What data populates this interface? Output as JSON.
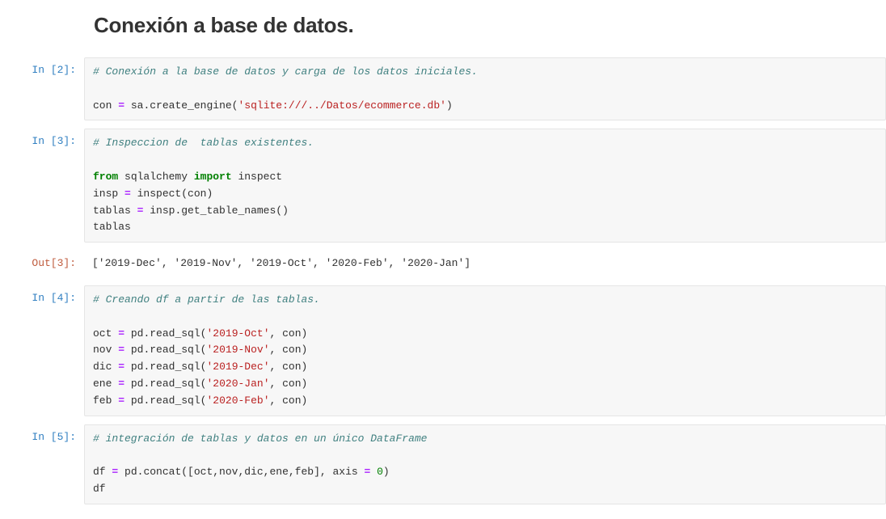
{
  "heading": "Conexión a base de datos.",
  "cells": [
    {
      "prompt": "In [2]:",
      "type": "input",
      "tokens": [
        {
          "t": "# Conexión a la base de datos y carga de los datos iniciales.",
          "c": "comment"
        },
        {
          "t": "\n\n",
          "c": "punct"
        },
        {
          "t": "con ",
          "c": "name"
        },
        {
          "t": "=",
          "c": "operator"
        },
        {
          "t": " sa",
          "c": "name"
        },
        {
          "t": ".",
          "c": "punct"
        },
        {
          "t": "create_engine",
          "c": "name"
        },
        {
          "t": "(",
          "c": "punct"
        },
        {
          "t": "'sqlite:///../Datos/ecommerce.db'",
          "c": "string"
        },
        {
          "t": ")",
          "c": "punct"
        }
      ]
    },
    {
      "prompt": "In [3]:",
      "type": "input",
      "tokens": [
        {
          "t": "# Inspeccion de  tablas existentes.",
          "c": "comment"
        },
        {
          "t": "\n\n",
          "c": "punct"
        },
        {
          "t": "from",
          "c": "keyword"
        },
        {
          "t": " sqlalchemy ",
          "c": "name"
        },
        {
          "t": "import",
          "c": "keyword"
        },
        {
          "t": " inspect\n",
          "c": "name"
        },
        {
          "t": "insp ",
          "c": "name"
        },
        {
          "t": "=",
          "c": "operator"
        },
        {
          "t": " inspect(con)\n",
          "c": "name"
        },
        {
          "t": "tablas ",
          "c": "name"
        },
        {
          "t": "=",
          "c": "operator"
        },
        {
          "t": " insp",
          "c": "name"
        },
        {
          "t": ".",
          "c": "punct"
        },
        {
          "t": "get_table_names()\n",
          "c": "name"
        },
        {
          "t": "tablas",
          "c": "name"
        }
      ]
    },
    {
      "prompt": "Out[3]:",
      "type": "output",
      "text": "['2019-Dec', '2019-Nov', '2019-Oct', '2020-Feb', '2020-Jan']"
    },
    {
      "prompt": "In [4]:",
      "type": "input",
      "tokens": [
        {
          "t": "# Creando df a partir de las tablas.",
          "c": "comment"
        },
        {
          "t": "\n\n",
          "c": "punct"
        },
        {
          "t": "oct ",
          "c": "name"
        },
        {
          "t": "=",
          "c": "operator"
        },
        {
          "t": " pd",
          "c": "name"
        },
        {
          "t": ".",
          "c": "punct"
        },
        {
          "t": "read_sql",
          "c": "name"
        },
        {
          "t": "(",
          "c": "punct"
        },
        {
          "t": "'2019-Oct'",
          "c": "string"
        },
        {
          "t": ", con)\n",
          "c": "name"
        },
        {
          "t": "nov ",
          "c": "name"
        },
        {
          "t": "=",
          "c": "operator"
        },
        {
          "t": " pd",
          "c": "name"
        },
        {
          "t": ".",
          "c": "punct"
        },
        {
          "t": "read_sql",
          "c": "name"
        },
        {
          "t": "(",
          "c": "punct"
        },
        {
          "t": "'2019-Nov'",
          "c": "string"
        },
        {
          "t": ", con)\n",
          "c": "name"
        },
        {
          "t": "dic ",
          "c": "name"
        },
        {
          "t": "=",
          "c": "operator"
        },
        {
          "t": " pd",
          "c": "name"
        },
        {
          "t": ".",
          "c": "punct"
        },
        {
          "t": "read_sql",
          "c": "name"
        },
        {
          "t": "(",
          "c": "punct"
        },
        {
          "t": "'2019-Dec'",
          "c": "string"
        },
        {
          "t": ", con)\n",
          "c": "name"
        },
        {
          "t": "ene ",
          "c": "name"
        },
        {
          "t": "=",
          "c": "operator"
        },
        {
          "t": " pd",
          "c": "name"
        },
        {
          "t": ".",
          "c": "punct"
        },
        {
          "t": "read_sql",
          "c": "name"
        },
        {
          "t": "(",
          "c": "punct"
        },
        {
          "t": "'2020-Jan'",
          "c": "string"
        },
        {
          "t": ", con)\n",
          "c": "name"
        },
        {
          "t": "feb ",
          "c": "name"
        },
        {
          "t": "=",
          "c": "operator"
        },
        {
          "t": " pd",
          "c": "name"
        },
        {
          "t": ".",
          "c": "punct"
        },
        {
          "t": "read_sql",
          "c": "name"
        },
        {
          "t": "(",
          "c": "punct"
        },
        {
          "t": "'2020-Feb'",
          "c": "string"
        },
        {
          "t": ", con)",
          "c": "name"
        }
      ]
    },
    {
      "prompt": "In [5]:",
      "type": "input",
      "tokens": [
        {
          "t": "# integración de tablas y datos en un único DataFrame",
          "c": "comment"
        },
        {
          "t": "\n\n",
          "c": "punct"
        },
        {
          "t": "df ",
          "c": "name"
        },
        {
          "t": "=",
          "c": "operator"
        },
        {
          "t": " pd",
          "c": "name"
        },
        {
          "t": ".",
          "c": "punct"
        },
        {
          "t": "concat([oct,nov,dic,ene,feb], axis ",
          "c": "name"
        },
        {
          "t": "=",
          "c": "operator"
        },
        {
          "t": " ",
          "c": "name"
        },
        {
          "t": "0",
          "c": "number"
        },
        {
          "t": ")\n",
          "c": "name"
        },
        {
          "t": "df",
          "c": "name"
        }
      ]
    }
  ]
}
